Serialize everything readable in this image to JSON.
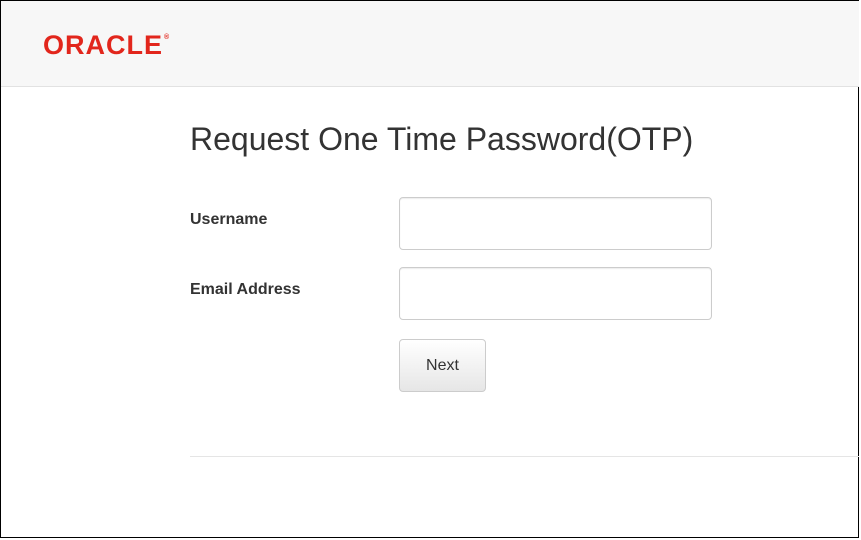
{
  "header": {
    "logo_text": "ORACLE",
    "logo_mark": "®"
  },
  "form": {
    "title": "Request One Time Password(OTP)",
    "username_label": "Username",
    "username_value": "",
    "email_label": "Email Address",
    "email_value": "",
    "next_label": "Next"
  },
  "colors": {
    "brand": "#e2261c",
    "text": "#333333",
    "header_bg": "#f7f7f7"
  }
}
